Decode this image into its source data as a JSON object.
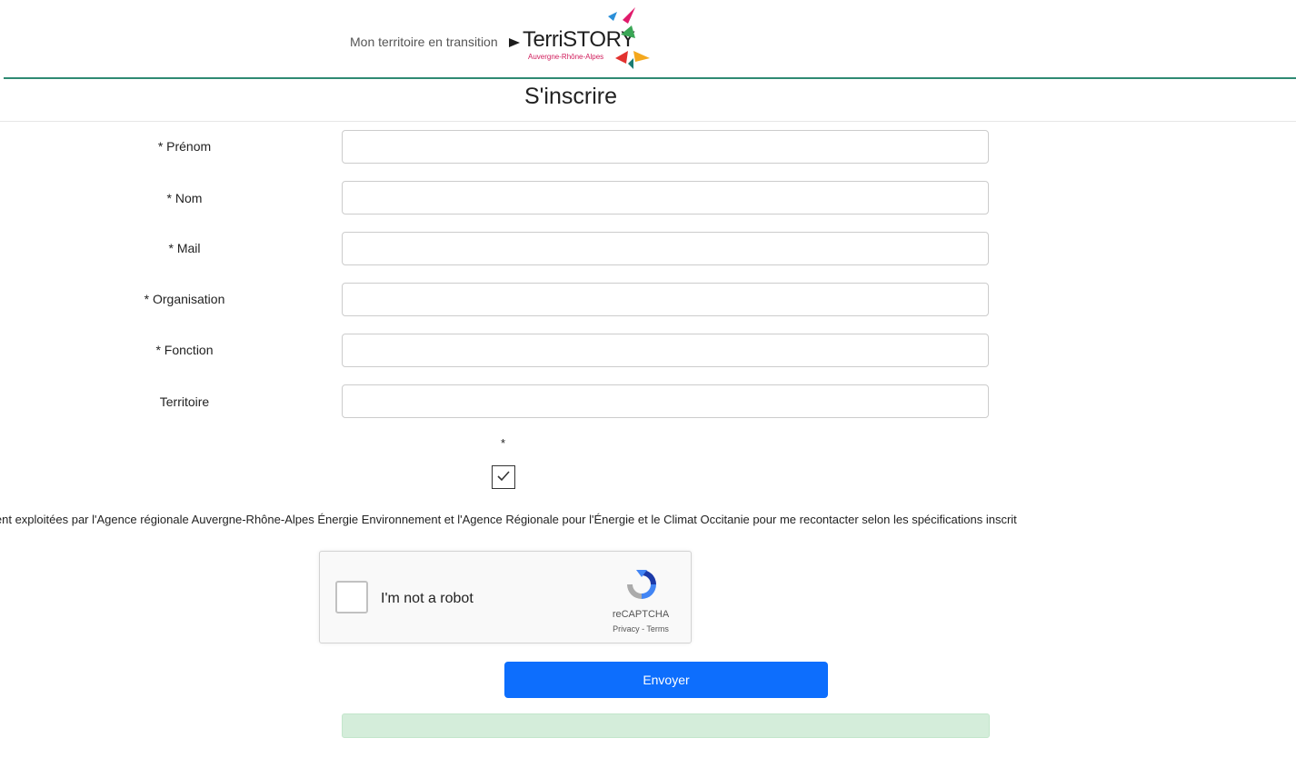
{
  "header": {
    "tagline": "Mon territoire en transition",
    "brand": "TerriSTORY",
    "brand_sub": "Auvergne-Rhône-Alpes"
  },
  "page_title": "S'inscrire",
  "form": {
    "fields": [
      {
        "label": "* Prénom",
        "value": "",
        "placeholder": ""
      },
      {
        "label": "* Nom",
        "value": "",
        "placeholder": ""
      },
      {
        "label": "* Mail",
        "value": "",
        "placeholder": ""
      },
      {
        "label": "* Organisation",
        "value": "",
        "placeholder": ""
      },
      {
        "label": "* Fonction",
        "value": "",
        "placeholder": ""
      },
      {
        "label": "Territoire",
        "value": "",
        "placeholder": ""
      }
    ],
    "consent_required_marker": "*",
    "consent_checked": true,
    "consent_text": "ient exploitées par l'Agence régionale Auvergne-Rhône-Alpes Énergie Environnement et l'Agence Régionale pour l'Énergie et le Climat Occitanie pour me recontacter selon les spécifications inscrit",
    "submit_label": "Envoyer"
  },
  "recaptcha": {
    "label": "I'm not a robot",
    "brand": "reCAPTCHA",
    "links": "Privacy - Terms"
  },
  "colors": {
    "accent": "#0d6efd",
    "header_line": "#2f8a73",
    "status_bg": "#d4edda"
  },
  "icons": [
    "logo-arrow-icon",
    "checkmark-icon",
    "recaptcha-logo-icon"
  ]
}
